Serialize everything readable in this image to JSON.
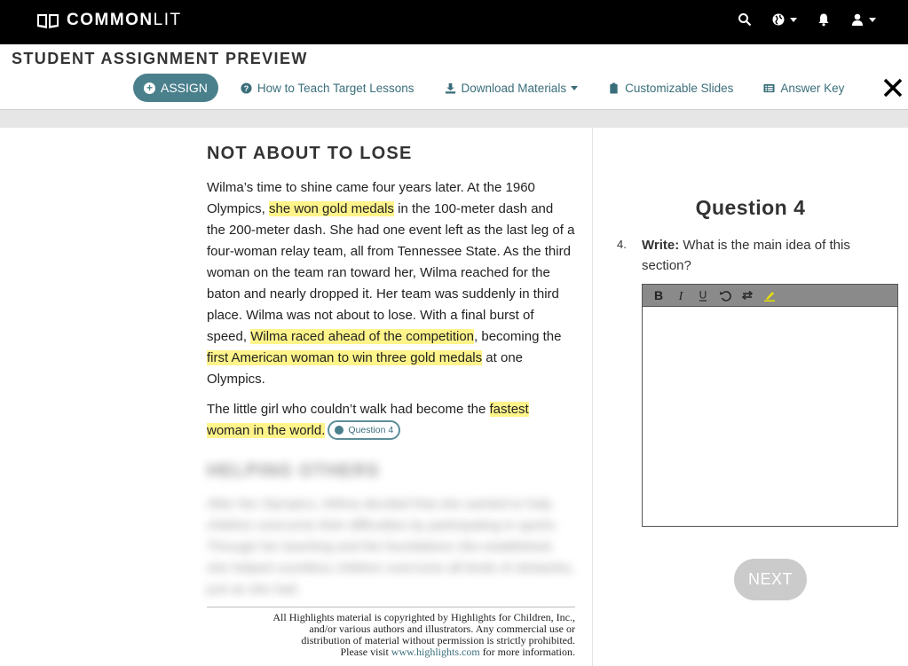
{
  "brand": {
    "common": "COMMON",
    "lit": "LIT"
  },
  "topbar": {
    "icons": [
      "search-icon",
      "globe-icon",
      "bell-icon",
      "user-icon"
    ]
  },
  "preview": {
    "title": "STUDENT ASSIGNMENT PREVIEW",
    "assign_label": "ASSIGN",
    "links": [
      {
        "label": "How to Teach Target Lessons",
        "icon": "question-circle-icon"
      },
      {
        "label": "Download Materials",
        "icon": "download-icon"
      },
      {
        "label": "Customizable Slides",
        "icon": "clipboard-icon"
      },
      {
        "label": "Answer Key",
        "icon": "list-icon"
      }
    ],
    "close_icon": "close-icon"
  },
  "reading": {
    "heading": "NOT ABOUT TO LOSE",
    "p1": {
      "t1": "Wilma’s time to shine came four years later. At the 1960 Olympics, ",
      "h1": "she won gold medals",
      "t2": " in the 100-meter dash and the 200-meter dash. She had one event left as the last leg of a four-woman relay team, all from Tennessee State. As the third woman on the team ran toward her, Wilma reached for the baton and nearly dropped it. Her team was suddenly in third place. Wilma was not about to lose. With a final burst of speed, ",
      "h2": "Wilma raced ahead of the competition",
      "t3": ", becoming the ",
      "h3": "first American woman to win three gold medals",
      "t4": " at one Olympics."
    },
    "p2": {
      "t1": "The little girl who couldn’t walk had become the ",
      "h1": "fastest woman in the world.",
      "badge": "Question 4"
    },
    "blurred_heading": "HELPING OTHERS",
    "blurred_text": "After the Olympics, Wilma decided that she wanted to help children overcome their difficulties by participating in sports. Through her teaching and the foundations she established, she helped countless children overcome all kinds of obstacles, just as she had.",
    "copyright": {
      "line1": "All Highlights material is copyrighted by Highlights for Children, Inc.,",
      "line2": "and/or various authors and illustrators. Any commercial use or",
      "line3": "distribution of material without permission is strictly prohibited.",
      "line4_pre": "Please visit ",
      "link": "www.highlights.com",
      "line4_post": " for more information."
    }
  },
  "question": {
    "title": "Question 4",
    "number": "4.",
    "prompt_bold": "Write:",
    "prompt": " What is the main idea of this section?",
    "editor_tools": [
      "bold-icon",
      "italic-icon",
      "underline-icon",
      "undo-icon",
      "redo-icon",
      "highlight-icon"
    ],
    "next_label": "NEXT"
  },
  "colors": {
    "accent": "#4a7f8c",
    "link": "#3a6e7b",
    "highlight": "#fff48a",
    "next_disabled": "#cbcbcb"
  }
}
